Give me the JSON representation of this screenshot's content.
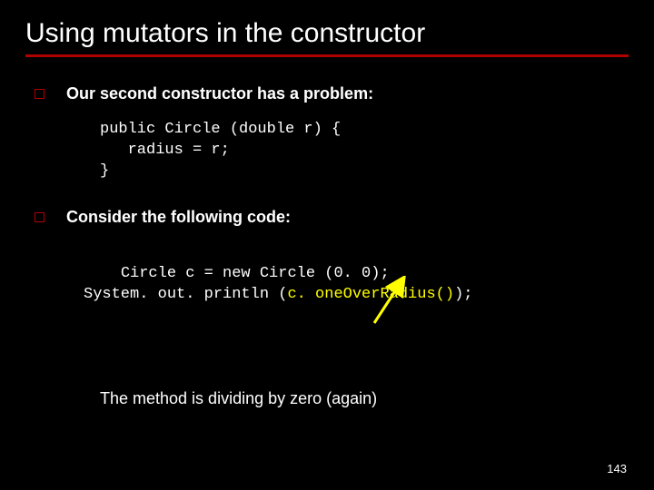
{
  "title": "Using mutators in the constructor",
  "bullets": {
    "b1": "Our second constructor has a problem:",
    "b2": "Consider the following code:"
  },
  "code1": "public Circle (double r) {\n   radius = r;\n}",
  "code2_line1_pre": "Circle c = new Circle (0. 0);",
  "code2_line2_pre": "System. out. println (",
  "code2_line2_hl": "c. oneOverRadius()",
  "code2_line2_post": ");",
  "conclusion": "The method is dividing by zero (again)",
  "page": "143"
}
